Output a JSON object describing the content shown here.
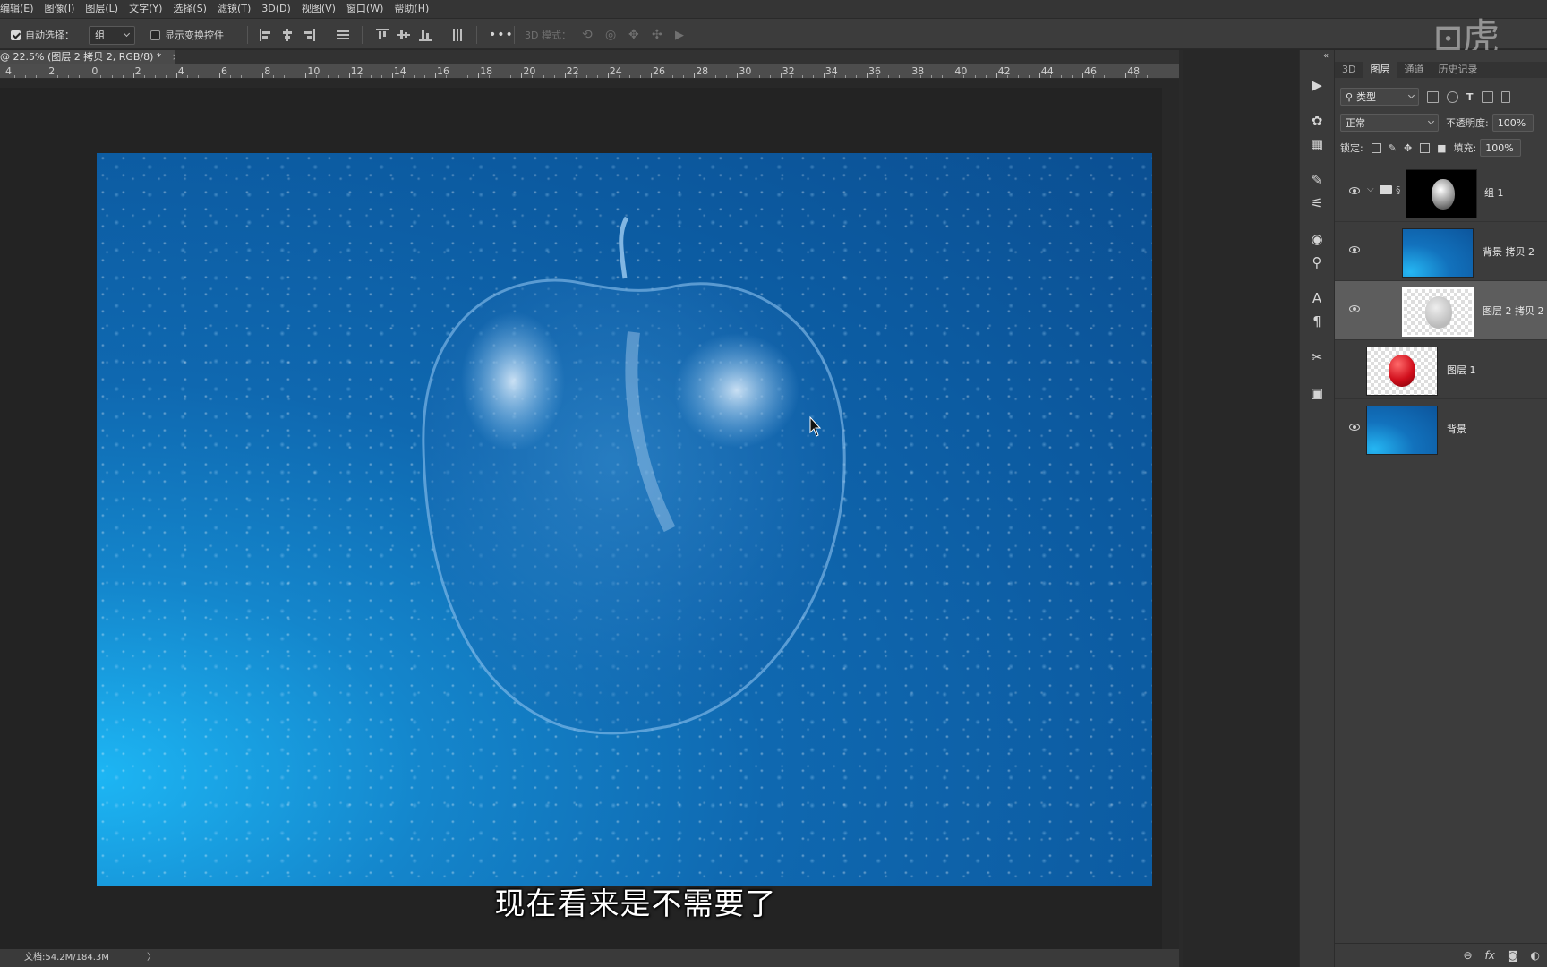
{
  "menu": {
    "items": [
      "编辑(E)",
      "图像(I)",
      "图层(L)",
      "文字(Y)",
      "选择(S)",
      "滤镜(T)",
      "3D(D)",
      "视图(V)",
      "窗口(W)",
      "帮助(H)"
    ]
  },
  "options_bar": {
    "auto_select_label": "自动选择：",
    "auto_select_checked": true,
    "auto_select_value": "组",
    "show_transform_label": "显示变换控件",
    "show_transform_checked": false,
    "more_label": "•••",
    "mode_3d_label": "3D 模式："
  },
  "watermark": "虎课",
  "document": {
    "tab_title": "@ 22.5% (图层 2 拷贝 2, RGB/8) *",
    "close_glyph": "×",
    "zoom_percent": 22.5
  },
  "ruler": {
    "labels": [
      "4",
      "2",
      "0",
      "2",
      "4",
      "6",
      "8",
      "10",
      "12",
      "14",
      "16",
      "18",
      "20",
      "22",
      "24",
      "26",
      "28",
      "30",
      "32",
      "34",
      "36",
      "38",
      "40",
      "42",
      "44",
      "46",
      "48"
    ]
  },
  "subtitle": "现在看来是不需要了",
  "status_bar": {
    "doc_info": "文档:54.2M/184.3M",
    "arrow": "〉"
  },
  "panel": {
    "collapse_glyph": "«",
    "tabs": [
      "3D",
      "图层",
      "通道",
      "历史记录"
    ],
    "active_tab": "图层",
    "filter_kind": "类型",
    "blend_mode": "正常",
    "opacity_label": "不透明度:",
    "opacity_value": "100%",
    "lock_label": "锁定:",
    "fill_label": "填充:",
    "fill_value": "100%",
    "bottom_icons": [
      "link-icon",
      "fx-icon",
      "mask-icon",
      "adjustment-icon"
    ],
    "fx_label": "fx"
  },
  "layers": [
    {
      "name": "组 1",
      "visible": true,
      "type": "group",
      "selected": false
    },
    {
      "name": "背景 拷贝 2",
      "visible": true,
      "type": "image",
      "selected": false
    },
    {
      "name": "图层 2 拷贝 2",
      "visible": true,
      "type": "image",
      "selected": true
    },
    {
      "name": "图层 1",
      "visible": false,
      "type": "image",
      "selected": false
    },
    {
      "name": "背景",
      "visible": true,
      "type": "image",
      "selected": false
    }
  ],
  "colors": {
    "canvas_blue": "#0c5aa0",
    "canvas_cyan": "#1db6f4",
    "ui_dark": "#282828",
    "panel_gray": "#3c3c3c",
    "selected_layer": "#5d5d5d"
  }
}
